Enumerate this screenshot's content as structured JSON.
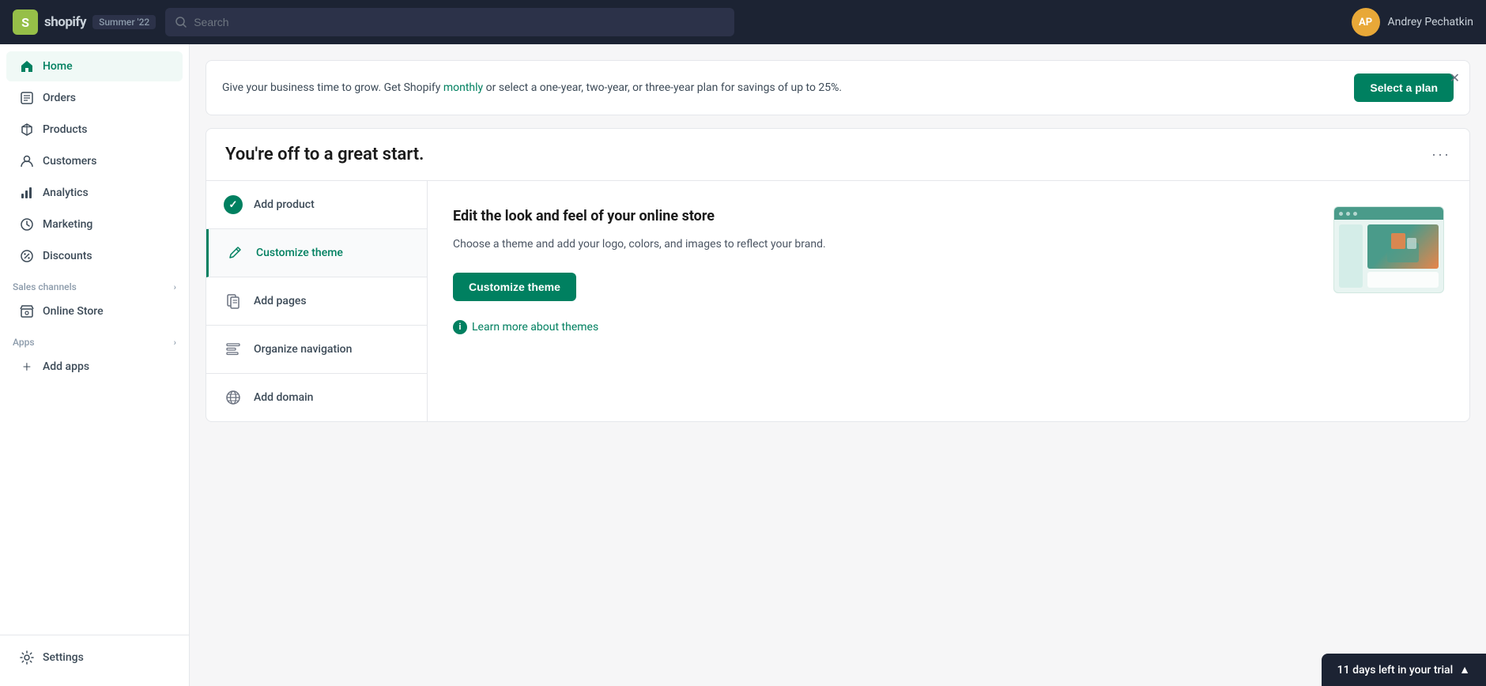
{
  "topbar": {
    "logo_text": "shopify",
    "badge": "Summer '22",
    "search_placeholder": "Search",
    "user_initials": "AP",
    "user_name": "Andrey Pechatkin"
  },
  "sidebar": {
    "nav_items": [
      {
        "id": "home",
        "label": "Home",
        "icon": "home-icon",
        "active": true
      },
      {
        "id": "orders",
        "label": "Orders",
        "icon": "orders-icon",
        "active": false
      },
      {
        "id": "products",
        "label": "Products",
        "icon": "products-icon",
        "active": false
      },
      {
        "id": "customers",
        "label": "Customers",
        "icon": "customers-icon",
        "active": false
      },
      {
        "id": "analytics",
        "label": "Analytics",
        "icon": "analytics-icon",
        "active": false
      },
      {
        "id": "marketing",
        "label": "Marketing",
        "icon": "marketing-icon",
        "active": false
      },
      {
        "id": "discounts",
        "label": "Discounts",
        "icon": "discounts-icon",
        "active": false
      }
    ],
    "sales_channels_label": "Sales channels",
    "sales_channels_items": [
      {
        "id": "online-store",
        "label": "Online Store",
        "icon": "store-icon"
      }
    ],
    "apps_label": "Apps",
    "add_apps_label": "Add apps",
    "settings_label": "Settings"
  },
  "banner": {
    "text_before_link": "Give your business time to grow. Get Shopify ",
    "link_text": "monthly",
    "text_after_link": " or select a one-year, two-year, or three-year plan for savings of up to 25%.",
    "button_label": "Select a plan"
  },
  "setup_card": {
    "title": "You're off to a great start.",
    "more_icon": "···",
    "steps": [
      {
        "id": "add-product",
        "label": "Add product",
        "completed": true,
        "active": false
      },
      {
        "id": "customize-theme",
        "label": "Customize theme",
        "completed": false,
        "active": true
      },
      {
        "id": "add-pages",
        "label": "Add pages",
        "completed": false,
        "active": false
      },
      {
        "id": "organize-navigation",
        "label": "Organize navigation",
        "completed": false,
        "active": false
      },
      {
        "id": "add-domain",
        "label": "Add domain",
        "completed": false,
        "active": false
      }
    ],
    "detail": {
      "title": "Edit the look and feel of your online store",
      "description": "Choose a theme and add your logo, colors, and images to reflect your brand.",
      "button_label": "Customize theme",
      "learn_more_label": "Learn more about themes"
    }
  },
  "trial_bar": {
    "text": "11 days left in your trial",
    "arrow": "▲"
  }
}
